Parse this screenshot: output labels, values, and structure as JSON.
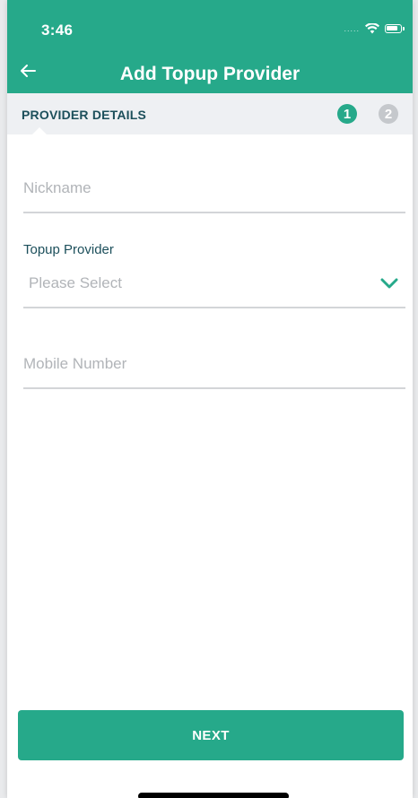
{
  "status_bar": {
    "time": "3:46",
    "signal": ".....",
    "wifi_icon": "wifi-icon",
    "battery_icon": "battery-icon"
  },
  "header": {
    "back_icon": "arrow-left-icon",
    "title": "Add Topup Provider",
    "background": "#26a98a"
  },
  "subheader": {
    "label": "PROVIDER DETAILS",
    "steps": [
      {
        "label": "1",
        "active": true
      },
      {
        "label": "2",
        "active": false
      }
    ]
  },
  "form": {
    "nickname": {
      "placeholder": "Nickname",
      "value": ""
    },
    "topup_provider": {
      "label": "Topup Provider",
      "selected": "Please Select",
      "icon": "chevron-down-icon"
    },
    "mobile_number": {
      "placeholder": "Mobile Number",
      "value": ""
    }
  },
  "actions": {
    "next_label": "NEXT"
  },
  "colors": {
    "accent": "#26a98a",
    "label_dark": "#1c4f5b",
    "placeholder": "#b1b4b8",
    "inactive_step": "#c5c8cc"
  }
}
